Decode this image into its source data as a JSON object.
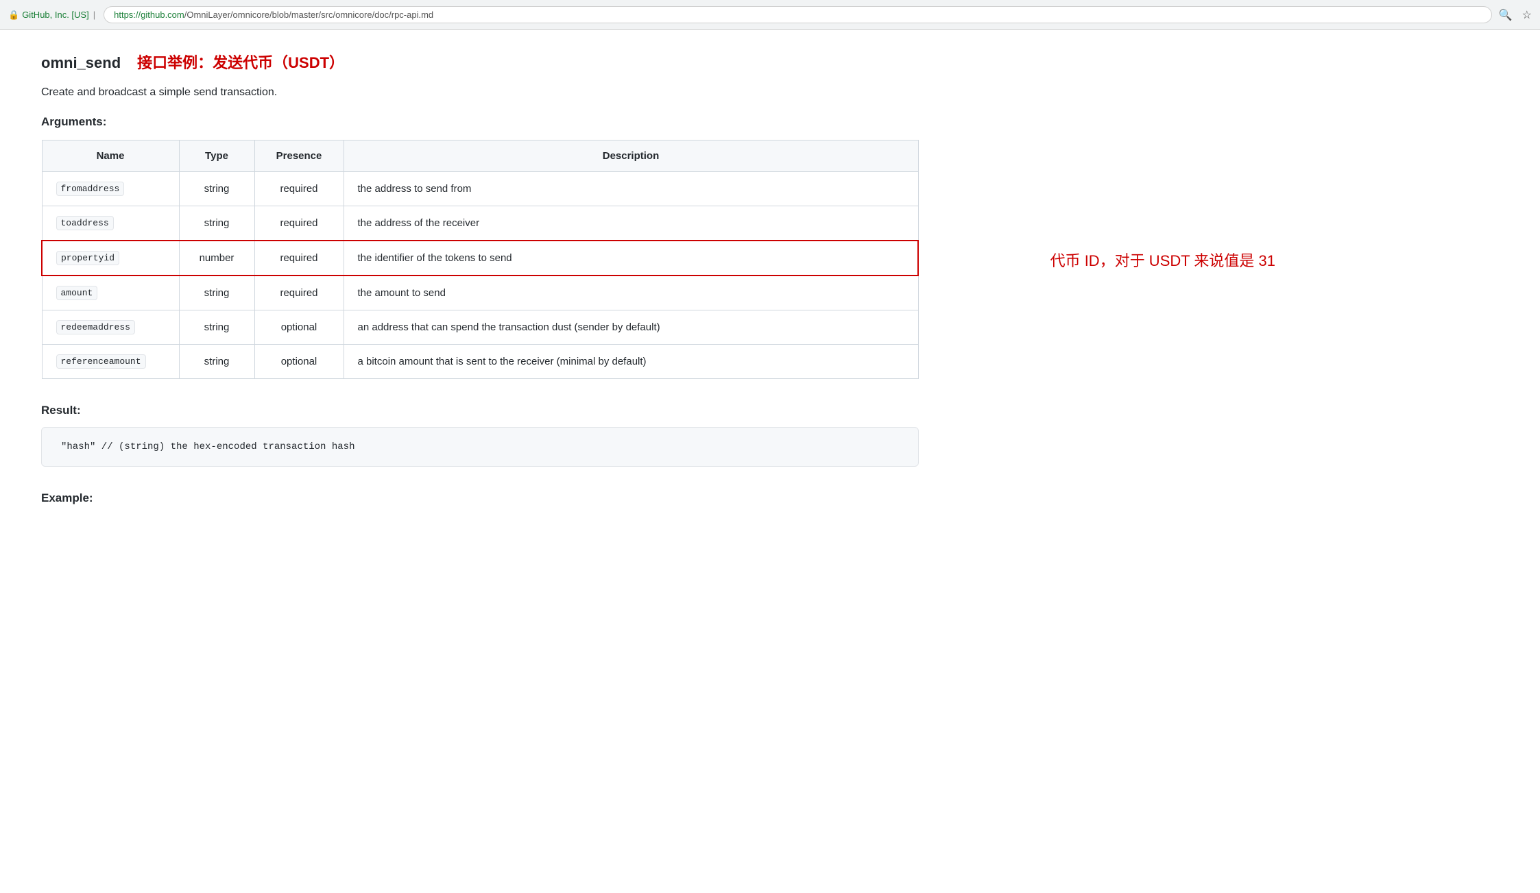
{
  "browser": {
    "security_label": "GitHub, Inc. [US]",
    "url_domain": "https://github.com",
    "url_path": "/OmniLayer/omnicore/blob/master/src/omnicore/doc/rpc-api.md",
    "search_icon": "🔍",
    "star_icon": "☆"
  },
  "page": {
    "title": "omni_send",
    "subtitle": "接口举例：发送代币（USDT）",
    "description": "Create and broadcast a simple send transaction.",
    "arguments_heading": "Arguments:",
    "table": {
      "headers": [
        "Name",
        "Type",
        "Presence",
        "Description"
      ],
      "rows": [
        {
          "name": "fromaddress",
          "type": "string",
          "presence": "required",
          "description": "the address to send from",
          "highlighted": false
        },
        {
          "name": "toaddress",
          "type": "string",
          "presence": "required",
          "description": "the address of the receiver",
          "highlighted": false
        },
        {
          "name": "propertyid",
          "type": "number",
          "presence": "required",
          "description": "the identifier of the tokens to send",
          "highlighted": true,
          "annotation": "代币 ID，对于 USDT 来说值是 31"
        },
        {
          "name": "amount",
          "type": "string",
          "presence": "required",
          "description": "the amount to send",
          "highlighted": false
        },
        {
          "name": "redeemaddress",
          "type": "string",
          "presence": "optional",
          "description": "an address that can spend the transaction dust (sender by default)",
          "highlighted": false
        },
        {
          "name": "referenceamount",
          "type": "string",
          "presence": "optional",
          "description": "a bitcoin amount that is sent to the receiver (minimal by default)",
          "highlighted": false
        }
      ]
    },
    "result_heading": "Result:",
    "result_code": "\"hash\"  // (string) the hex-encoded transaction hash",
    "example_heading": "Example:"
  }
}
